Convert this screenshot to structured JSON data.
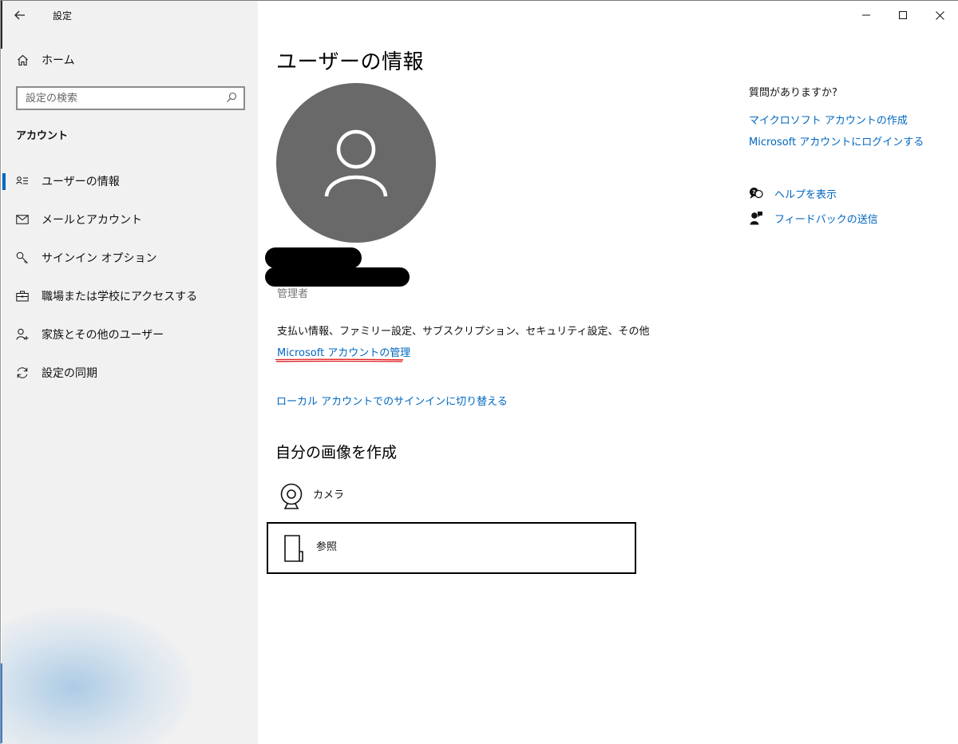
{
  "window": {
    "title": "設定",
    "controls": [
      "minimize",
      "maximize",
      "close"
    ]
  },
  "sidebar": {
    "home_label": "ホーム",
    "search_placeholder": "設定の検索",
    "section_title": "アカウント",
    "items": [
      {
        "label": "ユーザーの情報",
        "icon": "user-info-icon",
        "active": true
      },
      {
        "label": "メールとアカウント",
        "icon": "mail-icon",
        "active": false
      },
      {
        "label": "サインイン オプション",
        "icon": "key-icon",
        "active": false
      },
      {
        "label": "職場または学校にアクセスする",
        "icon": "briefcase-icon",
        "active": false
      },
      {
        "label": "家族とその他のユーザー",
        "icon": "add-person-icon",
        "active": false
      },
      {
        "label": "設定の同期",
        "icon": "sync-icon",
        "active": false
      }
    ]
  },
  "main": {
    "title": "ユーザーの情報",
    "role": "管理者",
    "description": "支払い情報、ファミリー設定、サブスクリプション、セキュリティ設定、その他",
    "manage_link": "Microsoft アカウントの管理",
    "local_link": "ローカル アカウントでのサインインに切り替える",
    "create_picture_title": "自分の画像を作成",
    "options": [
      {
        "label": "カメラ",
        "icon": "camera-icon"
      },
      {
        "label": "参照",
        "icon": "file-icon"
      }
    ]
  },
  "help": {
    "question_title": "質問がありますか?",
    "links": [
      "マイクロソフト アカウントの作成",
      "Microsoft アカウントにログインする"
    ],
    "help_label": "ヘルプを表示",
    "feedback_label": "フィードバックの送信"
  },
  "colors": {
    "accent": "#0067c0",
    "sidebar_bg": "#f1f1f1",
    "avatar_bg": "#696969",
    "annotation_red": "#e02020"
  }
}
